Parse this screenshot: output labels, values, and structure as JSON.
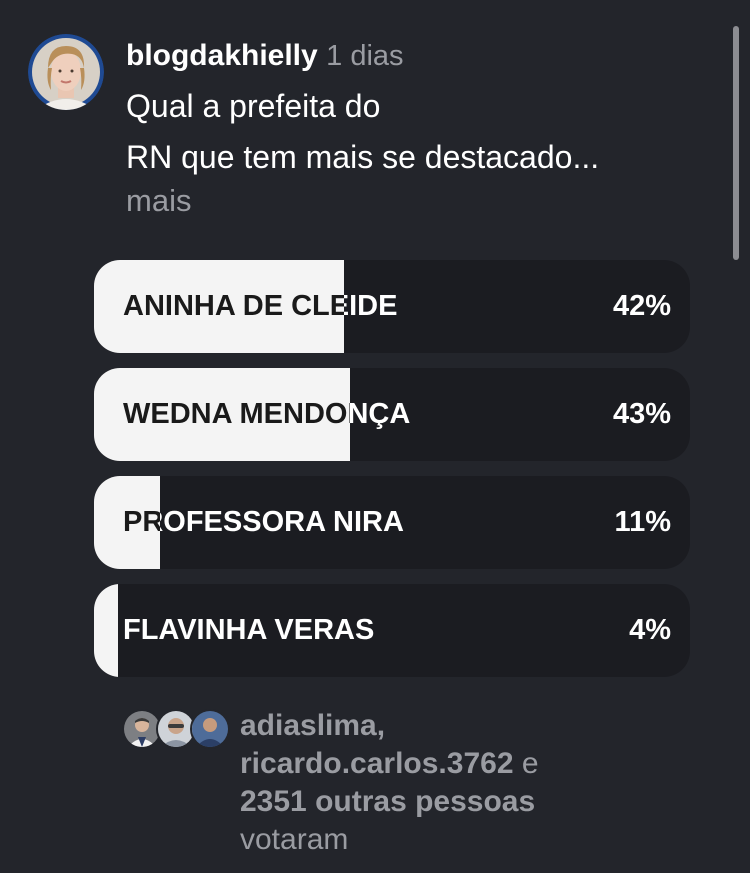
{
  "post": {
    "username": "blogdakhielly",
    "time": "1 dias",
    "caption_line1": "Qual a prefeita do",
    "caption_line2": "RN que tem mais se destacado...",
    "more": "mais"
  },
  "poll": {
    "options": [
      {
        "label": "ANINHA DE CLEIDE",
        "percent_text": "42%",
        "fill_fraction": 0.42
      },
      {
        "label": "WEDNA MENDONÇA",
        "percent_text": "43%",
        "fill_fraction": 0.43
      },
      {
        "label": "PROFESSORA NIRA",
        "percent_text": "11%",
        "fill_fraction": 0.11
      },
      {
        "label": "FLAVINHA VERAS",
        "percent_text": "4%",
        "fill_fraction": 0.04
      }
    ]
  },
  "voters": {
    "name1": "adiaslima,",
    "name2": "ricardo.carlos.3762",
    "connector": "e",
    "others": "2351 outras pessoas",
    "suffix": "votaram"
  },
  "colors": {
    "background": "#23252b",
    "option_track": "#1b1c21",
    "option_fill": "#f4f4f4",
    "muted_text": "#9a9ca2",
    "avatar_ring": "#1f4a93"
  }
}
